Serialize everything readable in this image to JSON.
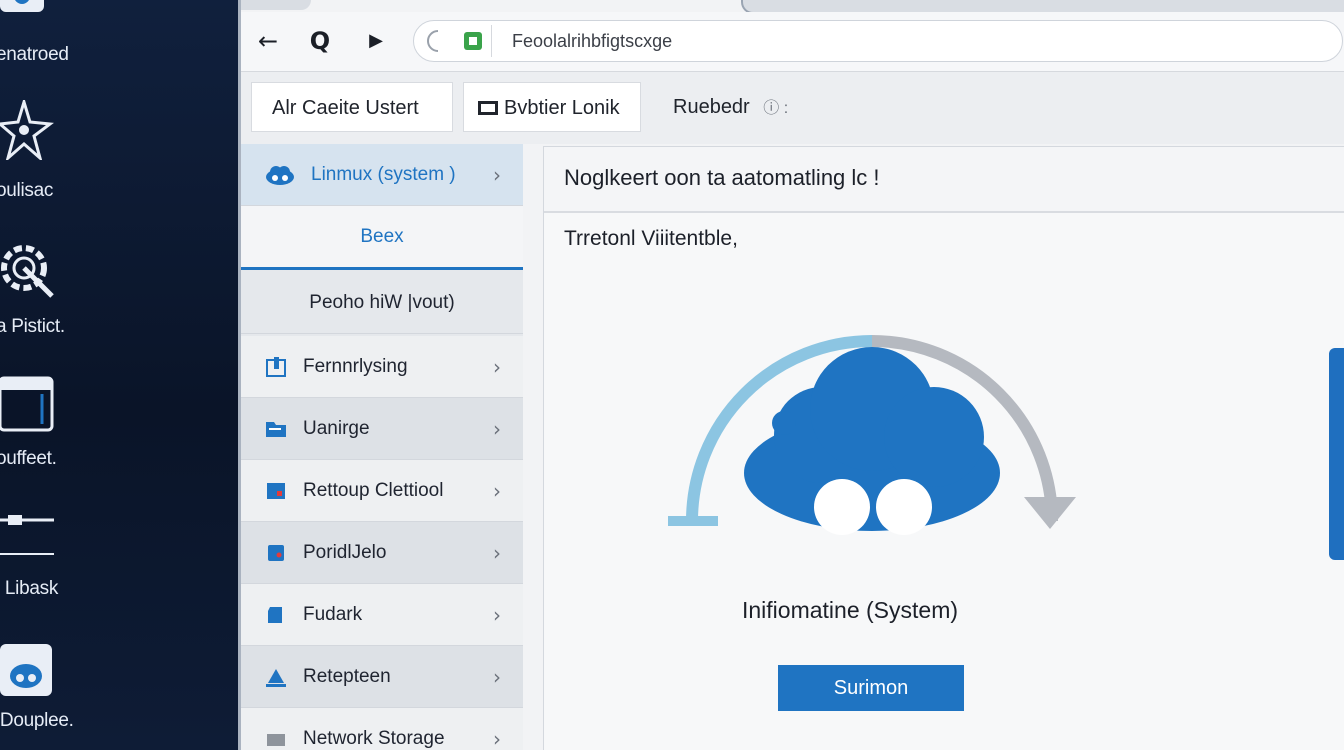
{
  "desktop": {
    "icons": [
      {
        "name": "network-icon",
        "label": "enatroed"
      },
      {
        "name": "star-icon",
        "label": "oulisac"
      },
      {
        "name": "gear-icon",
        "label": "a Pistict."
      },
      {
        "name": "folder-icon",
        "label": "ouffeet."
      },
      {
        "name": "drive-icon",
        "label": "i Libask"
      },
      {
        "name": "cloud-folder-icon",
        "label": "lDouplee."
      }
    ]
  },
  "browser": {
    "nav": {
      "back": "←",
      "search": "Q",
      "forward": "▶"
    },
    "url": "Feoolalrihbfigtscxge",
    "bookmarks": [
      {
        "label": "Alr Caeite Ustert"
      },
      {
        "label": "Bvbtier Lonik"
      },
      {
        "label": "Ruebedr"
      }
    ]
  },
  "sidebar": {
    "items": [
      {
        "label": "Linmux (system )",
        "icon": "cloud-icon",
        "chevron": "›"
      },
      {
        "label": "Beex"
      },
      {
        "label": "Peoho hiW |vout)"
      },
      {
        "label": "Fernnrlysing",
        "icon": "device-icon",
        "chevron": "›"
      },
      {
        "label": "Uanirge",
        "icon": "folder-icon",
        "chevron": "›"
      },
      {
        "label": "Rettoup Clettiool",
        "icon": "backup-icon",
        "chevron": "›"
      },
      {
        "label": "PoridlJelo",
        "icon": "drive-icon",
        "chevron": "›"
      },
      {
        "label": "Fudark",
        "icon": "server-icon",
        "chevron": "›"
      },
      {
        "label": "Retepteen",
        "icon": "user-icon",
        "chevron": "›"
      },
      {
        "label": "Network Storage",
        "icon": "storage-icon",
        "chevron": "›"
      }
    ]
  },
  "main": {
    "title": "Noglkeert oon ta aatomatling lc !",
    "subtitle": "Trretonl Viiitentble,",
    "progress": 0.5,
    "caption": "Inifiomatine (System)",
    "button_label": "Surimon"
  },
  "colors": {
    "accent": "#1f74c2",
    "arc_light": "#8cc5e2",
    "arc_gray": "#b5b9c0"
  }
}
